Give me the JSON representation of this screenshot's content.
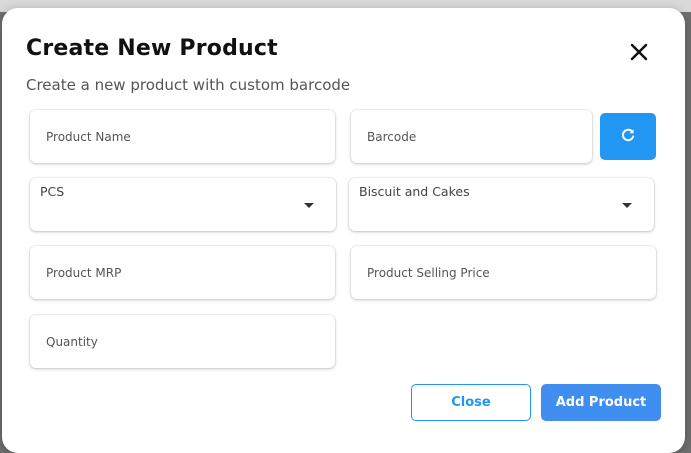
{
  "dialog": {
    "title": "Create New Product",
    "subtitle": "Create a new product with custom barcode",
    "close_icon": "close-icon"
  },
  "fields": {
    "product_name": {
      "placeholder": "Product Name",
      "value": ""
    },
    "barcode": {
      "placeholder": "Barcode",
      "value": ""
    },
    "unit": {
      "selected": "PCS"
    },
    "category": {
      "selected": "Biscuit and Cakes"
    },
    "product_mrp": {
      "placeholder": "Product MRP",
      "value": ""
    },
    "selling_price": {
      "placeholder": "Product Selling Price",
      "value": ""
    },
    "quantity": {
      "placeholder": "Quantity",
      "value": ""
    }
  },
  "actions": {
    "refresh_icon": "refresh-icon",
    "close_label": "Close",
    "add_label": "Add Product"
  },
  "colors": {
    "accent": "#2196f3",
    "primary_button": "#3f8ef0"
  }
}
